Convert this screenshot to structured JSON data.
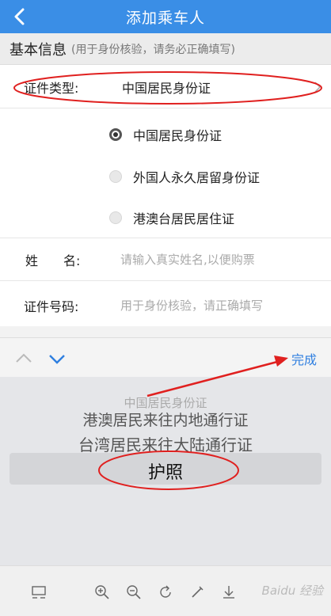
{
  "header": {
    "title": "添加乘车人"
  },
  "section": {
    "title": "基本信息",
    "subtitle": "(用于身份核验，请务必正确填写)"
  },
  "form": {
    "id_type_label": "证件类型:",
    "id_type_value": "中国居民身份证",
    "options": [
      {
        "label": "中国居民身份证",
        "checked": true
      },
      {
        "label": "外国人永久居留身份证",
        "checked": false
      },
      {
        "label": "港澳台居民居住证",
        "checked": false
      }
    ],
    "name_label": "姓　　名:",
    "name_placeholder": "请输入真实姓名,以便购票",
    "id_number_label": "证件号码:",
    "id_number_placeholder": "用于身份核验，请正确填写"
  },
  "picker": {
    "done_label": "完成",
    "items": [
      {
        "label": "中国居民身份证",
        "state": "faded"
      },
      {
        "label": "港澳居民来往内地通行证",
        "state": "normal"
      },
      {
        "label": "台湾居民来往大陆通行证",
        "state": "normal"
      },
      {
        "label": "护照",
        "state": "selected"
      }
    ]
  },
  "watermark": "Baidu 经验",
  "colors": {
    "header": "#3a8ee6",
    "accent": "#2f7fe0",
    "annotation": "#e0201f"
  },
  "icons": {
    "back": "chevron-left-icon",
    "row_arrow": "chevron-right-icon",
    "picker_up": "chevron-up-icon",
    "picker_down": "chevron-down-icon",
    "tools": [
      "layout-icon",
      "zoom-in-icon",
      "zoom-out-icon",
      "rotate-icon",
      "pen-icon",
      "download-icon"
    ]
  }
}
